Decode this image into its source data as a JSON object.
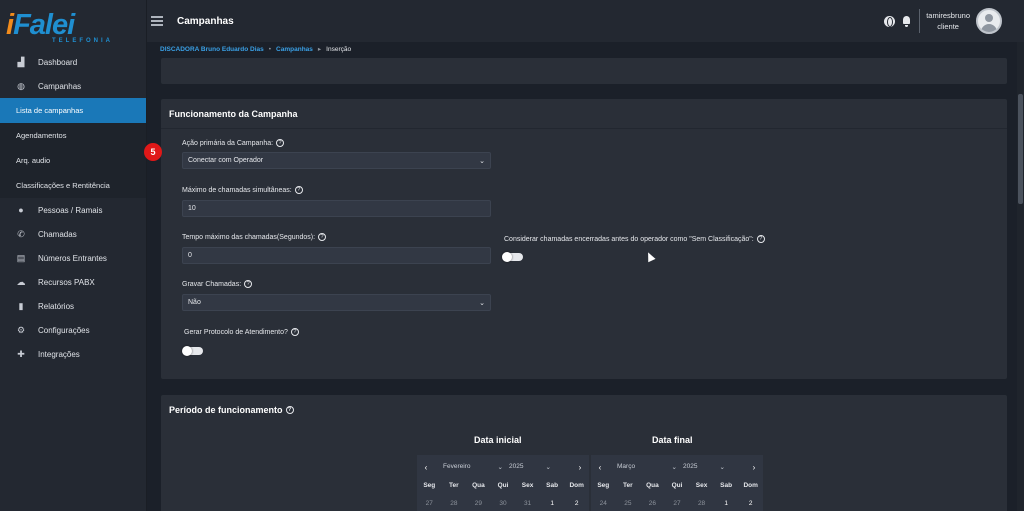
{
  "brand": {
    "logo_main": "iFalei",
    "logo_sub": "TELEFONIA",
    "accent": "#1a78b8",
    "logo_orange": "#f28c1c"
  },
  "topbar": {
    "title": "Campanhas",
    "user_name": "tamiresbruno",
    "user_role": "cliente"
  },
  "breadcrumb": {
    "item1": "DISCADORA Bruno Eduardo Dias",
    "item2": "Campanhas",
    "current": "Inserção"
  },
  "sidebar": {
    "dashboard": "Dashboard",
    "campanhas": "Campanhas",
    "lista": "Lista de campanhas",
    "agendamentos": "Agendamentos",
    "arq_audio": "Arq. audio",
    "classificacoes": "Classificações e Rentitência",
    "pessoas": "Pessoas / Ramais",
    "chamadas": "Chamadas",
    "numeros": "Números Entrantes",
    "recursos": "Recursos PABX",
    "relatorios": "Relatórios",
    "configuracoes": "Configurações",
    "integracoes": "Integrações"
  },
  "func": {
    "title": "Funcionamento da Campanha",
    "acao_label": "Ação primária da Campanha:",
    "acao_value": "Conectar com Operador",
    "max_label": "Máximo de chamadas simultâneas:",
    "max_value": "10",
    "tempo_label": "Tempo máximo das chamadas(Segundos):",
    "tempo_value": "0",
    "considerar_label": "Considerar chamadas encerradas antes do operador como \"Sem Classificação\":",
    "gravar_label": "Gravar Chamadas:",
    "gravar_value": "Não",
    "protocolo_label": "Gerar Protocolo de Atendimento?"
  },
  "badge": "5",
  "periodo": {
    "title": "Período de funcionamento",
    "inicial": "Data inicial",
    "final": "Data final",
    "cal1": {
      "month": "Fevereiro",
      "year": "2025"
    },
    "cal2": {
      "month": "Março",
      "year": "2025"
    },
    "days": [
      "Seg",
      "Ter",
      "Qua",
      "Qui",
      "Sex",
      "Sab",
      "Dom"
    ],
    "cal1_row1": [
      "27",
      "28",
      "29",
      "30",
      "31",
      "1",
      "2"
    ],
    "cal2_row1": [
      "24",
      "25",
      "26",
      "27",
      "28",
      "1",
      "2"
    ]
  }
}
